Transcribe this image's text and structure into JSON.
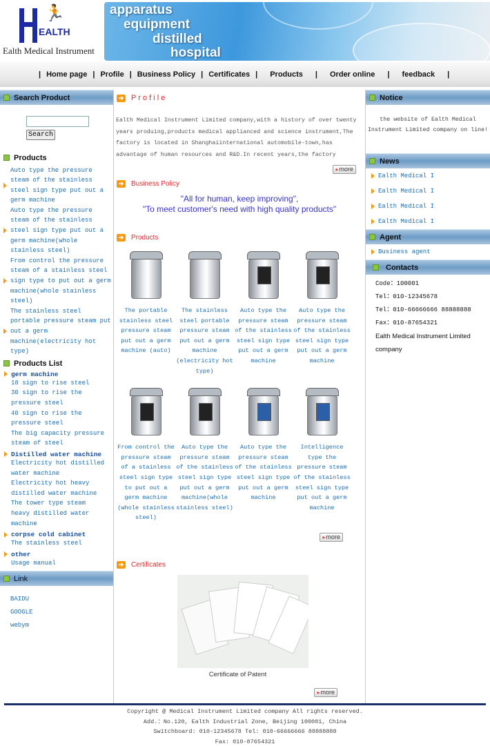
{
  "header": {
    "logo_word": "EALTH",
    "logo_name": "Ealth Medical Instrument",
    "banner_words": [
      "apparatus",
      "equipment",
      "distilled",
      "hospital"
    ]
  },
  "nav": {
    "items": [
      "Home page",
      "Profile",
      "Business Policy",
      "Certificates",
      "Products",
      "Order online",
      "feedback"
    ]
  },
  "left": {
    "search_title": "Search Product",
    "search_value": "",
    "search_button": "Search",
    "products_title": "Products",
    "products": [
      "Auto type the pressure steam of the stainless steel sign type put out a germ machine",
      "Auto type the pressure steam of the stainless steel sign type put out a germ machine(whole stainless steel)",
      "From control the pressure steam of a stainless steel sign type to put out a germ machine(whole stainless steel)",
      "The stainless steel portable pressure steam put out a germ machine(electricity hot type)"
    ],
    "list_title": "Products List",
    "categories": [
      {
        "name": "germ machine",
        "items": [
          "18 sign to rise steel",
          "30 sign to rise the pressure steel",
          "40 sign to rise the pressure steel",
          "The big capacity pressure steam of steel"
        ]
      },
      {
        "name": "Distilled water machine",
        "items": [
          "Electricity hot distilled water machine",
          "Electricity hot heavy distilled water machine",
          "The tower type steam heavy distilled water machine"
        ]
      },
      {
        "name": "corpse cold cabinet",
        "items": [
          "The stainless steel"
        ]
      },
      {
        "name": "other",
        "items": [
          "Usage manual"
        ]
      }
    ],
    "link_title": "Link",
    "links": [
      "BAIDU",
      "GOOGLE",
      "webym"
    ]
  },
  "center": {
    "profile_title": "P r o f i l e",
    "profile_text": "Ealth Medical Instrument Limited company,with a history of over twenty years produing,products medical applianced and science instrument,The factory is located in Shanghaiinternational automobile-town,has advantage of human resources and R&D.In recent years,the factory continually imports advanced technology from",
    "more": "more",
    "policy_title": "Business Policy",
    "policy_line1": "\"All for human, keep improving\",",
    "policy_line2": "\"To meet customer's need with high quality products\"",
    "policy_color": "#3333cc",
    "products_title": "Products",
    "products": [
      "The portable stainless steel pressure steam put out a germ machine (auto)",
      "The stainless steel portable pressure steam put out a germ machine (electricity hot type)",
      "Auto type the pressure steam of the stainless steel sign type put out a germ machine",
      "Auto type the pressure steam of the stainless steel sign type put out a germ machine",
      "From control the pressure steam of a stainless steel sign type to put out a germ machine (whole stainless steel)",
      "Auto type the pressure steam of the stainless steel sign type put out a germ machine(whole stainless steel)",
      "Auto type the pressure steam of the stainless steel sign type put out a germ machine",
      "Intelligence type the pressure steam of the stainless steel sign type put out a germ machine"
    ],
    "certificates_title": "Certificates",
    "certificate_caption": "Certificate of Patent"
  },
  "right": {
    "notice_title": "Notice",
    "notice_text": "the website of Ealth Medical Instrument Limited company on line!",
    "news_title": "News",
    "news": [
      "Ealth Medical I",
      "Ealth Medical I",
      "Ealth Medical I",
      "Ealth Medical I"
    ],
    "agent_title": "Agent",
    "agent_link": "Business agent",
    "contacts_title": "Contacts",
    "contacts": [
      "Code：100001",
      "Tel：010-12345678",
      "Tel：010-66666666 88888888",
      "Fax：010-87654321"
    ],
    "company": "Ealth Medical Instrument Limited company"
  },
  "footer": {
    "lines": [
      "Copyright @ Medical Instrument Limited company All rights reserved.",
      "Add.：No.120, Ealth Industrial Zone, Beijing 100001, China",
      "Switchboard: 010-12345678 Tel: 010-66666666 88888888",
      "Fax: 010-87654321"
    ]
  },
  "colors": {
    "accent": "#f39c12",
    "section_title": "#e8262a",
    "link": "#1a6cb5",
    "footer_bar": "#1b2d6b"
  }
}
